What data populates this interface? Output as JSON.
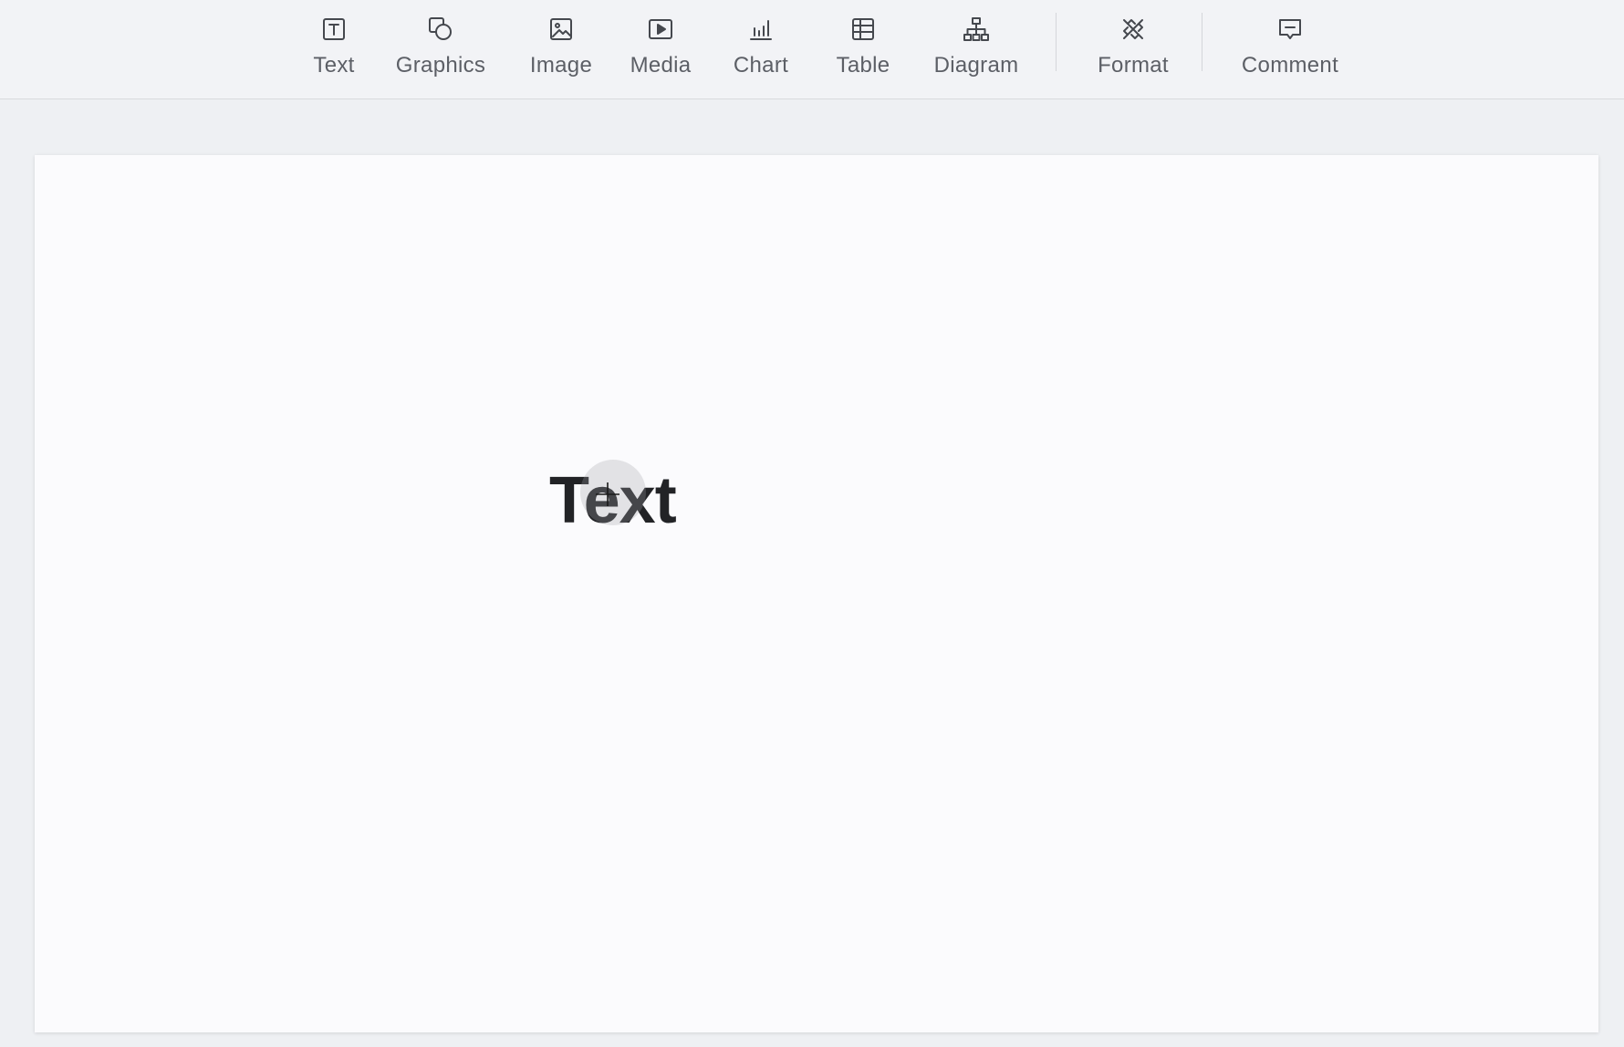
{
  "toolbar": {
    "tools": [
      {
        "label": "Text",
        "icon": "text-box-icon"
      },
      {
        "label": "Graphics",
        "icon": "shapes-icon"
      },
      {
        "label": "Image",
        "icon": "image-icon"
      },
      {
        "label": "Media",
        "icon": "media-play-icon"
      },
      {
        "label": "Chart",
        "icon": "bar-chart-icon"
      },
      {
        "label": "Table",
        "icon": "table-icon"
      },
      {
        "label": "Diagram",
        "icon": "org-chart-icon"
      },
      {
        "label": "Format",
        "icon": "format-brush-icon"
      },
      {
        "label": "Comment",
        "icon": "comment-icon"
      }
    ]
  },
  "slide": {
    "text_box": "Text"
  },
  "colors": {
    "toolbar_bg": "#f2f3f6",
    "canvas_bg": "#eef0f3",
    "slide_bg": "#fbfbfd",
    "icon": "#45484e",
    "label": "#5c5f66",
    "text": "#222326"
  }
}
